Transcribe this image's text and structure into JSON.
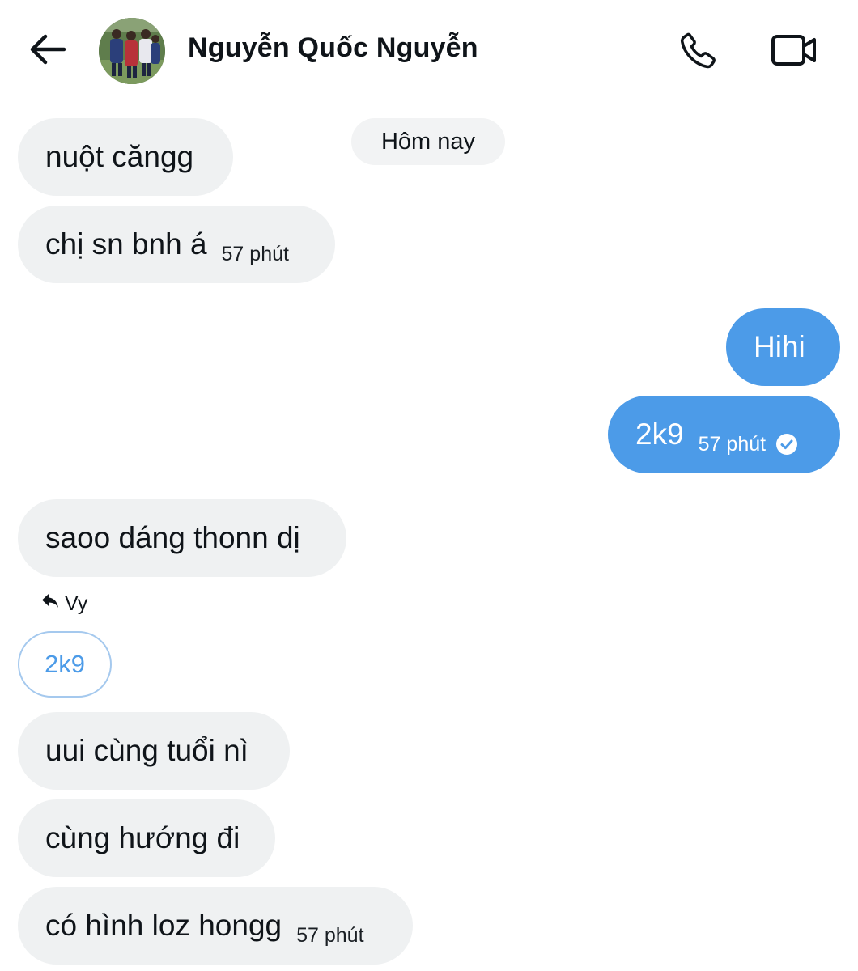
{
  "header": {
    "contact_name": "Nguyễn Quốc Nguyễn",
    "back_icon": "arrow-left-icon",
    "call_icon": "phone-icon",
    "video_icon": "video-camera-icon"
  },
  "date_divider": "Hôm nay",
  "messages": [
    {
      "direction": "incoming",
      "text": "nuột căngg"
    },
    {
      "direction": "incoming",
      "text": "chị sn bnh á",
      "time": "57 phút"
    },
    {
      "direction": "outgoing",
      "text": "Hihi"
    },
    {
      "direction": "outgoing",
      "text": "2k9",
      "time": "57 phút",
      "status_icon": "check-circle-icon"
    },
    {
      "direction": "incoming",
      "text": "saoo dáng thonn dị"
    },
    {
      "direction": "incoming",
      "text": "uui cùng tuổi nì"
    },
    {
      "direction": "incoming",
      "text": "cùng hướng đi"
    },
    {
      "direction": "incoming",
      "text": "có hình loz hongg",
      "time": "57 phút"
    }
  ],
  "reply": {
    "reply_to_name": "Vy",
    "quoted_text": "2k9",
    "icon": "reply-arrow-icon"
  },
  "colors": {
    "outgoing_bubble": "#4c9be8",
    "incoming_bubble": "#eff1f2",
    "accent": "#4c9be8"
  }
}
